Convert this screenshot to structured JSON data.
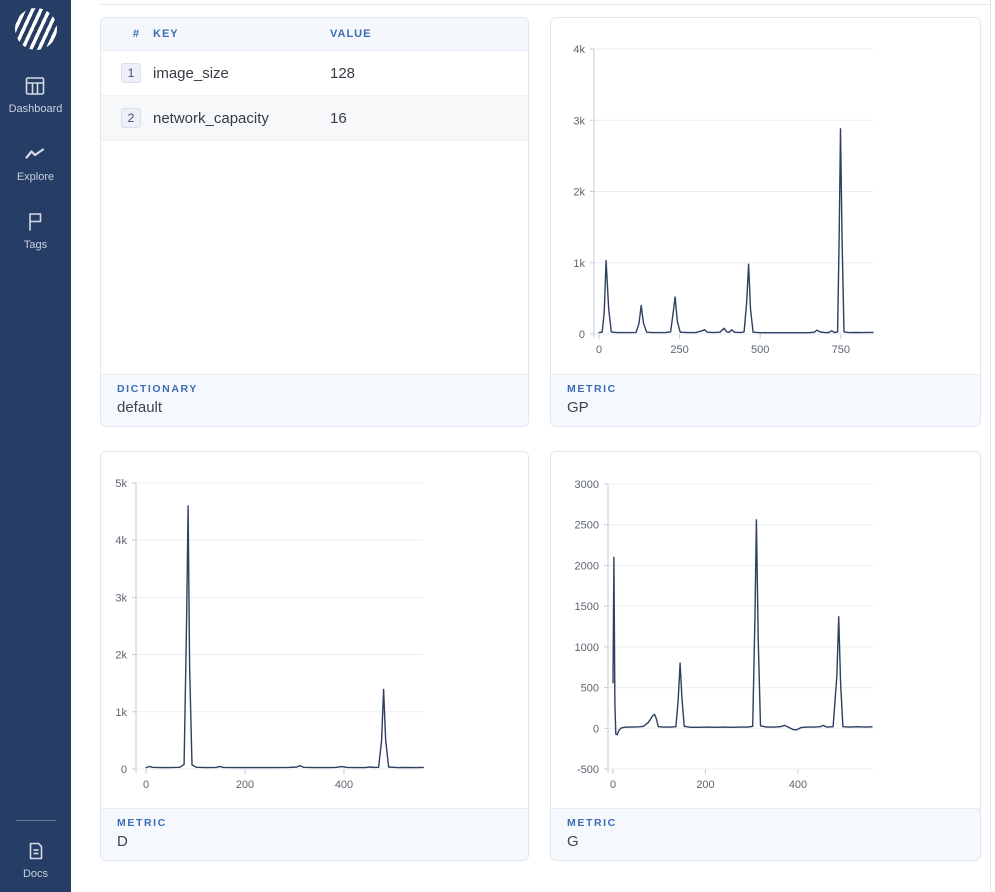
{
  "colors": {
    "sidebar_bg": "#263d66",
    "accent_blue": "#3c6cb4",
    "chart_line": "#2e3f60",
    "footer_bg": "#f5f9fe",
    "table_header_bg": "#f4f8fd"
  },
  "sidebar": {
    "items": [
      {
        "icon": "dashboard-icon",
        "label": "Dashboard"
      },
      {
        "icon": "explore-icon",
        "label": "Explore"
      },
      {
        "icon": "tags-icon",
        "label": "Tags"
      }
    ],
    "bottom_items": [
      {
        "icon": "docs-icon",
        "label": "Docs"
      }
    ]
  },
  "cards": {
    "dictionary": {
      "table": {
        "columns": [
          "#",
          "KEY",
          "VALUE"
        ],
        "rows": [
          {
            "index": "1",
            "key": "image_size",
            "value": "128"
          },
          {
            "index": "2",
            "key": "network_capacity",
            "value": "16"
          }
        ]
      },
      "footer": {
        "label": "DICTIONARY",
        "value": "default"
      }
    },
    "metric_gp": {
      "footer": {
        "label": "METRIC",
        "value": "GP"
      },
      "chart": {
        "type": "line",
        "xlim": [
          0,
          850
        ],
        "ylim": [
          0,
          4000
        ],
        "xticks": [
          {
            "v": 0,
            "label": "0"
          },
          {
            "v": 250,
            "label": "250"
          },
          {
            "v": 500,
            "label": "500"
          },
          {
            "v": 750,
            "label": "750"
          }
        ],
        "yticks": [
          {
            "v": 0,
            "label": "0"
          },
          {
            "v": 1000,
            "label": "1k"
          },
          {
            "v": 2000,
            "label": "2k"
          },
          {
            "v": 3000,
            "label": "3k"
          },
          {
            "v": 4000,
            "label": "4k"
          }
        ],
        "points": [
          [
            0,
            20
          ],
          [
            10,
            25
          ],
          [
            16,
            300
          ],
          [
            22,
            1030
          ],
          [
            30,
            350
          ],
          [
            38,
            30
          ],
          [
            55,
            20
          ],
          [
            75,
            20
          ],
          [
            95,
            20
          ],
          [
            115,
            22
          ],
          [
            124,
            150
          ],
          [
            131,
            400
          ],
          [
            138,
            150
          ],
          [
            148,
            25
          ],
          [
            165,
            20
          ],
          [
            185,
            20
          ],
          [
            205,
            20
          ],
          [
            222,
            30
          ],
          [
            230,
            300
          ],
          [
            236,
            520
          ],
          [
            243,
            180
          ],
          [
            252,
            25
          ],
          [
            275,
            20
          ],
          [
            300,
            20
          ],
          [
            320,
            45
          ],
          [
            328,
            60
          ],
          [
            336,
            25
          ],
          [
            355,
            20
          ],
          [
            375,
            25
          ],
          [
            388,
            80
          ],
          [
            396,
            30
          ],
          [
            404,
            25
          ],
          [
            412,
            60
          ],
          [
            420,
            25
          ],
          [
            438,
            20
          ],
          [
            450,
            30
          ],
          [
            458,
            450
          ],
          [
            464,
            980
          ],
          [
            470,
            350
          ],
          [
            478,
            25
          ],
          [
            500,
            18
          ],
          [
            525,
            18
          ],
          [
            550,
            18
          ],
          [
            575,
            18
          ],
          [
            600,
            18
          ],
          [
            625,
            18
          ],
          [
            650,
            18
          ],
          [
            668,
            25
          ],
          [
            676,
            55
          ],
          [
            686,
            28
          ],
          [
            700,
            20
          ],
          [
            712,
            20
          ],
          [
            722,
            45
          ],
          [
            730,
            20
          ],
          [
            740,
            30
          ],
          [
            745,
            1400
          ],
          [
            749,
            2880
          ],
          [
            754,
            1300
          ],
          [
            760,
            30
          ],
          [
            775,
            20
          ],
          [
            795,
            22
          ],
          [
            815,
            20
          ],
          [
            835,
            22
          ],
          [
            850,
            22
          ]
        ]
      }
    },
    "metric_d": {
      "footer": {
        "label": "METRIC",
        "value": "D"
      },
      "chart": {
        "type": "line",
        "xlim": [
          0,
          560
        ],
        "ylim": [
          0,
          5000
        ],
        "xticks": [
          {
            "v": 0,
            "label": "0"
          },
          {
            "v": 200,
            "label": "200"
          },
          {
            "v": 400,
            "label": "400"
          }
        ],
        "yticks": [
          {
            "v": 0,
            "label": "0"
          },
          {
            "v": 1000,
            "label": "1k"
          },
          {
            "v": 2000,
            "label": "2k"
          },
          {
            "v": 3000,
            "label": "3k"
          },
          {
            "v": 4000,
            "label": "4k"
          },
          {
            "v": 5000,
            "label": "5k"
          }
        ],
        "points": [
          [
            0,
            25
          ],
          [
            7,
            45
          ],
          [
            13,
            30
          ],
          [
            28,
            25
          ],
          [
            48,
            25
          ],
          [
            68,
            30
          ],
          [
            77,
            80
          ],
          [
            82,
            2600
          ],
          [
            85,
            4600
          ],
          [
            88,
            1800
          ],
          [
            93,
            70
          ],
          [
            102,
            30
          ],
          [
            122,
            25
          ],
          [
            142,
            28
          ],
          [
            149,
            45
          ],
          [
            156,
            28
          ],
          [
            178,
            25
          ],
          [
            200,
            25
          ],
          [
            222,
            25
          ],
          [
            244,
            25
          ],
          [
            266,
            25
          ],
          [
            288,
            28
          ],
          [
            305,
            35
          ],
          [
            311,
            60
          ],
          [
            318,
            30
          ],
          [
            340,
            25
          ],
          [
            362,
            25
          ],
          [
            382,
            28
          ],
          [
            396,
            42
          ],
          [
            406,
            28
          ],
          [
            422,
            25
          ],
          [
            442,
            25
          ],
          [
            454,
            35
          ],
          [
            462,
            28
          ],
          [
            470,
            30
          ],
          [
            476,
            500
          ],
          [
            480,
            1390
          ],
          [
            484,
            520
          ],
          [
            490,
            35
          ],
          [
            508,
            25
          ],
          [
            526,
            28
          ],
          [
            544,
            25
          ],
          [
            560,
            28
          ]
        ]
      }
    },
    "metric_g": {
      "footer": {
        "label": "METRIC",
        "value": "G"
      },
      "chart": {
        "type": "line",
        "xlim": [
          0,
          560
        ],
        "ylim": [
          -500,
          3000
        ],
        "xticks": [
          {
            "v": 0,
            "label": "0"
          },
          {
            "v": 200,
            "label": "200"
          },
          {
            "v": 400,
            "label": "400"
          }
        ],
        "yticks": [
          {
            "v": -500,
            "label": "-500"
          },
          {
            "v": 0,
            "label": "0"
          },
          {
            "v": 500,
            "label": "500"
          },
          {
            "v": 1000,
            "label": "1000"
          },
          {
            "v": 1500,
            "label": "1500"
          },
          {
            "v": 2000,
            "label": "2000"
          },
          {
            "v": 2500,
            "label": "2500"
          },
          {
            "v": 3000,
            "label": "3000"
          }
        ],
        "points": [
          [
            0,
            560
          ],
          [
            2,
            2100
          ],
          [
            4,
            300
          ],
          [
            6,
            -70
          ],
          [
            9,
            -80
          ],
          [
            13,
            -25
          ],
          [
            18,
            5
          ],
          [
            28,
            15
          ],
          [
            42,
            15
          ],
          [
            56,
            18
          ],
          [
            66,
            25
          ],
          [
            76,
            70
          ],
          [
            86,
            155
          ],
          [
            90,
            170
          ],
          [
            94,
            110
          ],
          [
            98,
            20
          ],
          [
            110,
            15
          ],
          [
            124,
            14
          ],
          [
            136,
            20
          ],
          [
            141,
            350
          ],
          [
            145,
            800
          ],
          [
            149,
            380
          ],
          [
            154,
            25
          ],
          [
            168,
            12
          ],
          [
            186,
            12
          ],
          [
            204,
            15
          ],
          [
            222,
            12
          ],
          [
            240,
            15
          ],
          [
            258,
            12
          ],
          [
            276,
            15
          ],
          [
            292,
            15
          ],
          [
            302,
            25
          ],
          [
            307,
            1400
          ],
          [
            310,
            2560
          ],
          [
            314,
            1100
          ],
          [
            319,
            30
          ],
          [
            332,
            15
          ],
          [
            348,
            15
          ],
          [
            362,
            20
          ],
          [
            371,
            35
          ],
          [
            379,
            15
          ],
          [
            389,
            -15
          ],
          [
            397,
            -20
          ],
          [
            407,
            10
          ],
          [
            420,
            15
          ],
          [
            434,
            15
          ],
          [
            448,
            20
          ],
          [
            455,
            35
          ],
          [
            462,
            15
          ],
          [
            476,
            20
          ],
          [
            484,
            650
          ],
          [
            488,
            1370
          ],
          [
            492,
            550
          ],
          [
            497,
            20
          ],
          [
            512,
            15
          ],
          [
            528,
            20
          ],
          [
            544,
            15
          ],
          [
            560,
            18
          ]
        ]
      }
    }
  }
}
